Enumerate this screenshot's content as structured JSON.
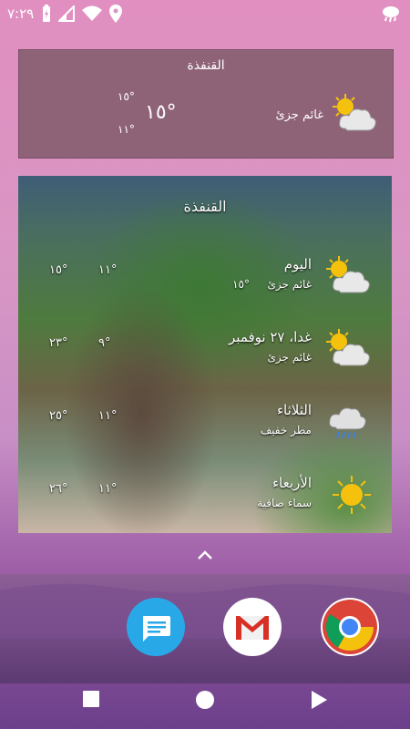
{
  "status": {
    "time": "٧:٢٩"
  },
  "small_widget": {
    "city": "القنفذة",
    "condition": "غائم جزئ",
    "temp": "١٥°",
    "high": "١٥°",
    "low": "١١°",
    "icon": "partly-cloudy-icon"
  },
  "big_widget": {
    "city": "القنفذة",
    "days": [
      {
        "day": "اليوم",
        "condition": "غائم جزئ",
        "inline_temp": "١٥°",
        "high": "١٥°",
        "low": "١١°",
        "icon": "partly-cloudy-icon"
      },
      {
        "day": "غدا، ٢٧ نوفمبر",
        "condition": "غائم جزئ",
        "high": "٢٣°",
        "low": "٩°",
        "icon": "partly-cloudy-icon"
      },
      {
        "day": "الثلاثاء",
        "condition": "مطر خفيف",
        "high": "٢٥°",
        "low": "١١°",
        "icon": "rain-cloud-icon"
      },
      {
        "day": "الأربعاء",
        "condition": "سماء صافية",
        "high": "٢٦°",
        "low": "١١°",
        "icon": "sun-icon"
      }
    ]
  },
  "dock": {
    "apps": [
      "messages-app-icon",
      "gmail-app-icon",
      "chrome-app-icon"
    ]
  },
  "colors": {
    "widget_bg": "#8f6377",
    "sun": "#f4c20d"
  }
}
